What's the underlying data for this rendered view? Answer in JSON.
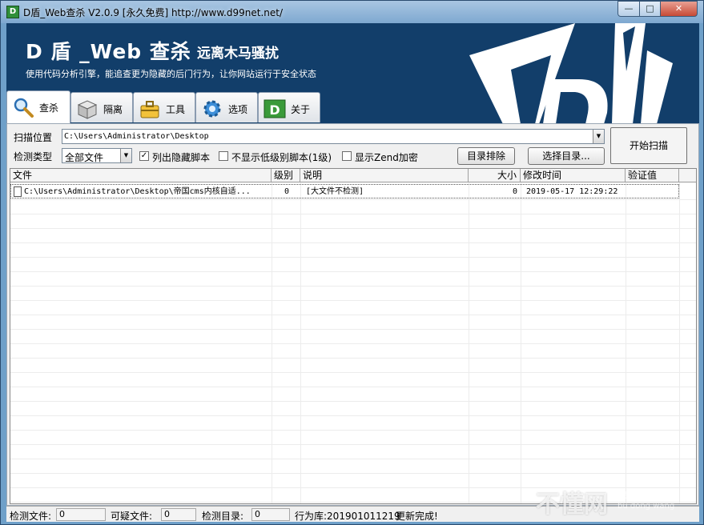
{
  "window": {
    "title": "D盾_Web查杀 V2.0.9 [永久免费] http://www.d99net.net/",
    "min_glyph": "—",
    "max_glyph": "□",
    "close_glyph": "✕"
  },
  "banner": {
    "title": "D 盾 _Web 查杀",
    "slogan": "远离木马骚扰",
    "subtitle": "使用代码分析引擎，能追查更为隐藏的后门行为，让你网站运行于安全状态"
  },
  "tabs": [
    {
      "label": "查杀",
      "icon": "magnifier-icon",
      "active": true
    },
    {
      "label": "隔离",
      "icon": "box-icon",
      "active": false
    },
    {
      "label": "工具",
      "icon": "toolbox-icon",
      "active": false
    },
    {
      "label": "选项",
      "icon": "gear-icon",
      "active": false
    },
    {
      "label": "关于",
      "icon": "d-logo-icon",
      "active": false
    }
  ],
  "scan": {
    "path_label": "扫描位置",
    "path_value": "C:\\Users\\Administrator\\Desktop",
    "type_label": "检测类型",
    "type_value": "全部文件",
    "chk_hidden": "列出隐藏脚本",
    "chk_hidden_checked": true,
    "chk_lowlevel": "不显示低级别脚本(1级)",
    "chk_lowlevel_checked": false,
    "chk_zend": "显示Zend加密",
    "chk_zend_checked": false,
    "exclude_button": "目录排除",
    "select_button": "选择目录...",
    "start_button": "开始扫描"
  },
  "table": {
    "headers": [
      "文件",
      "级别",
      "说明",
      "大小",
      "修改时间",
      "验证值"
    ],
    "rows": [
      {
        "file": "C:\\Users\\Administrator\\Desktop\\帝国cms内核自适...",
        "level": "0",
        "desc": "[大文件不检测]",
        "size": "0",
        "mtime": "2019-05-17 12:29:22",
        "hash": ""
      }
    ]
  },
  "status": {
    "files_label": "检测文件:",
    "files_value": "0",
    "suspicious_label": "可疑文件:",
    "suspicious_value": "0",
    "dirs_label": "检测目录:",
    "dirs_value": "0",
    "db_text": "行为库:201901011219",
    "update_text": "更新完成!"
  },
  "watermark": {
    "main": "不懂网",
    "tag": "爱分享",
    "url": "bu dong wang"
  },
  "colors": {
    "banner_bg": "#123e6a",
    "frame_blue": "#6fa0c9"
  }
}
